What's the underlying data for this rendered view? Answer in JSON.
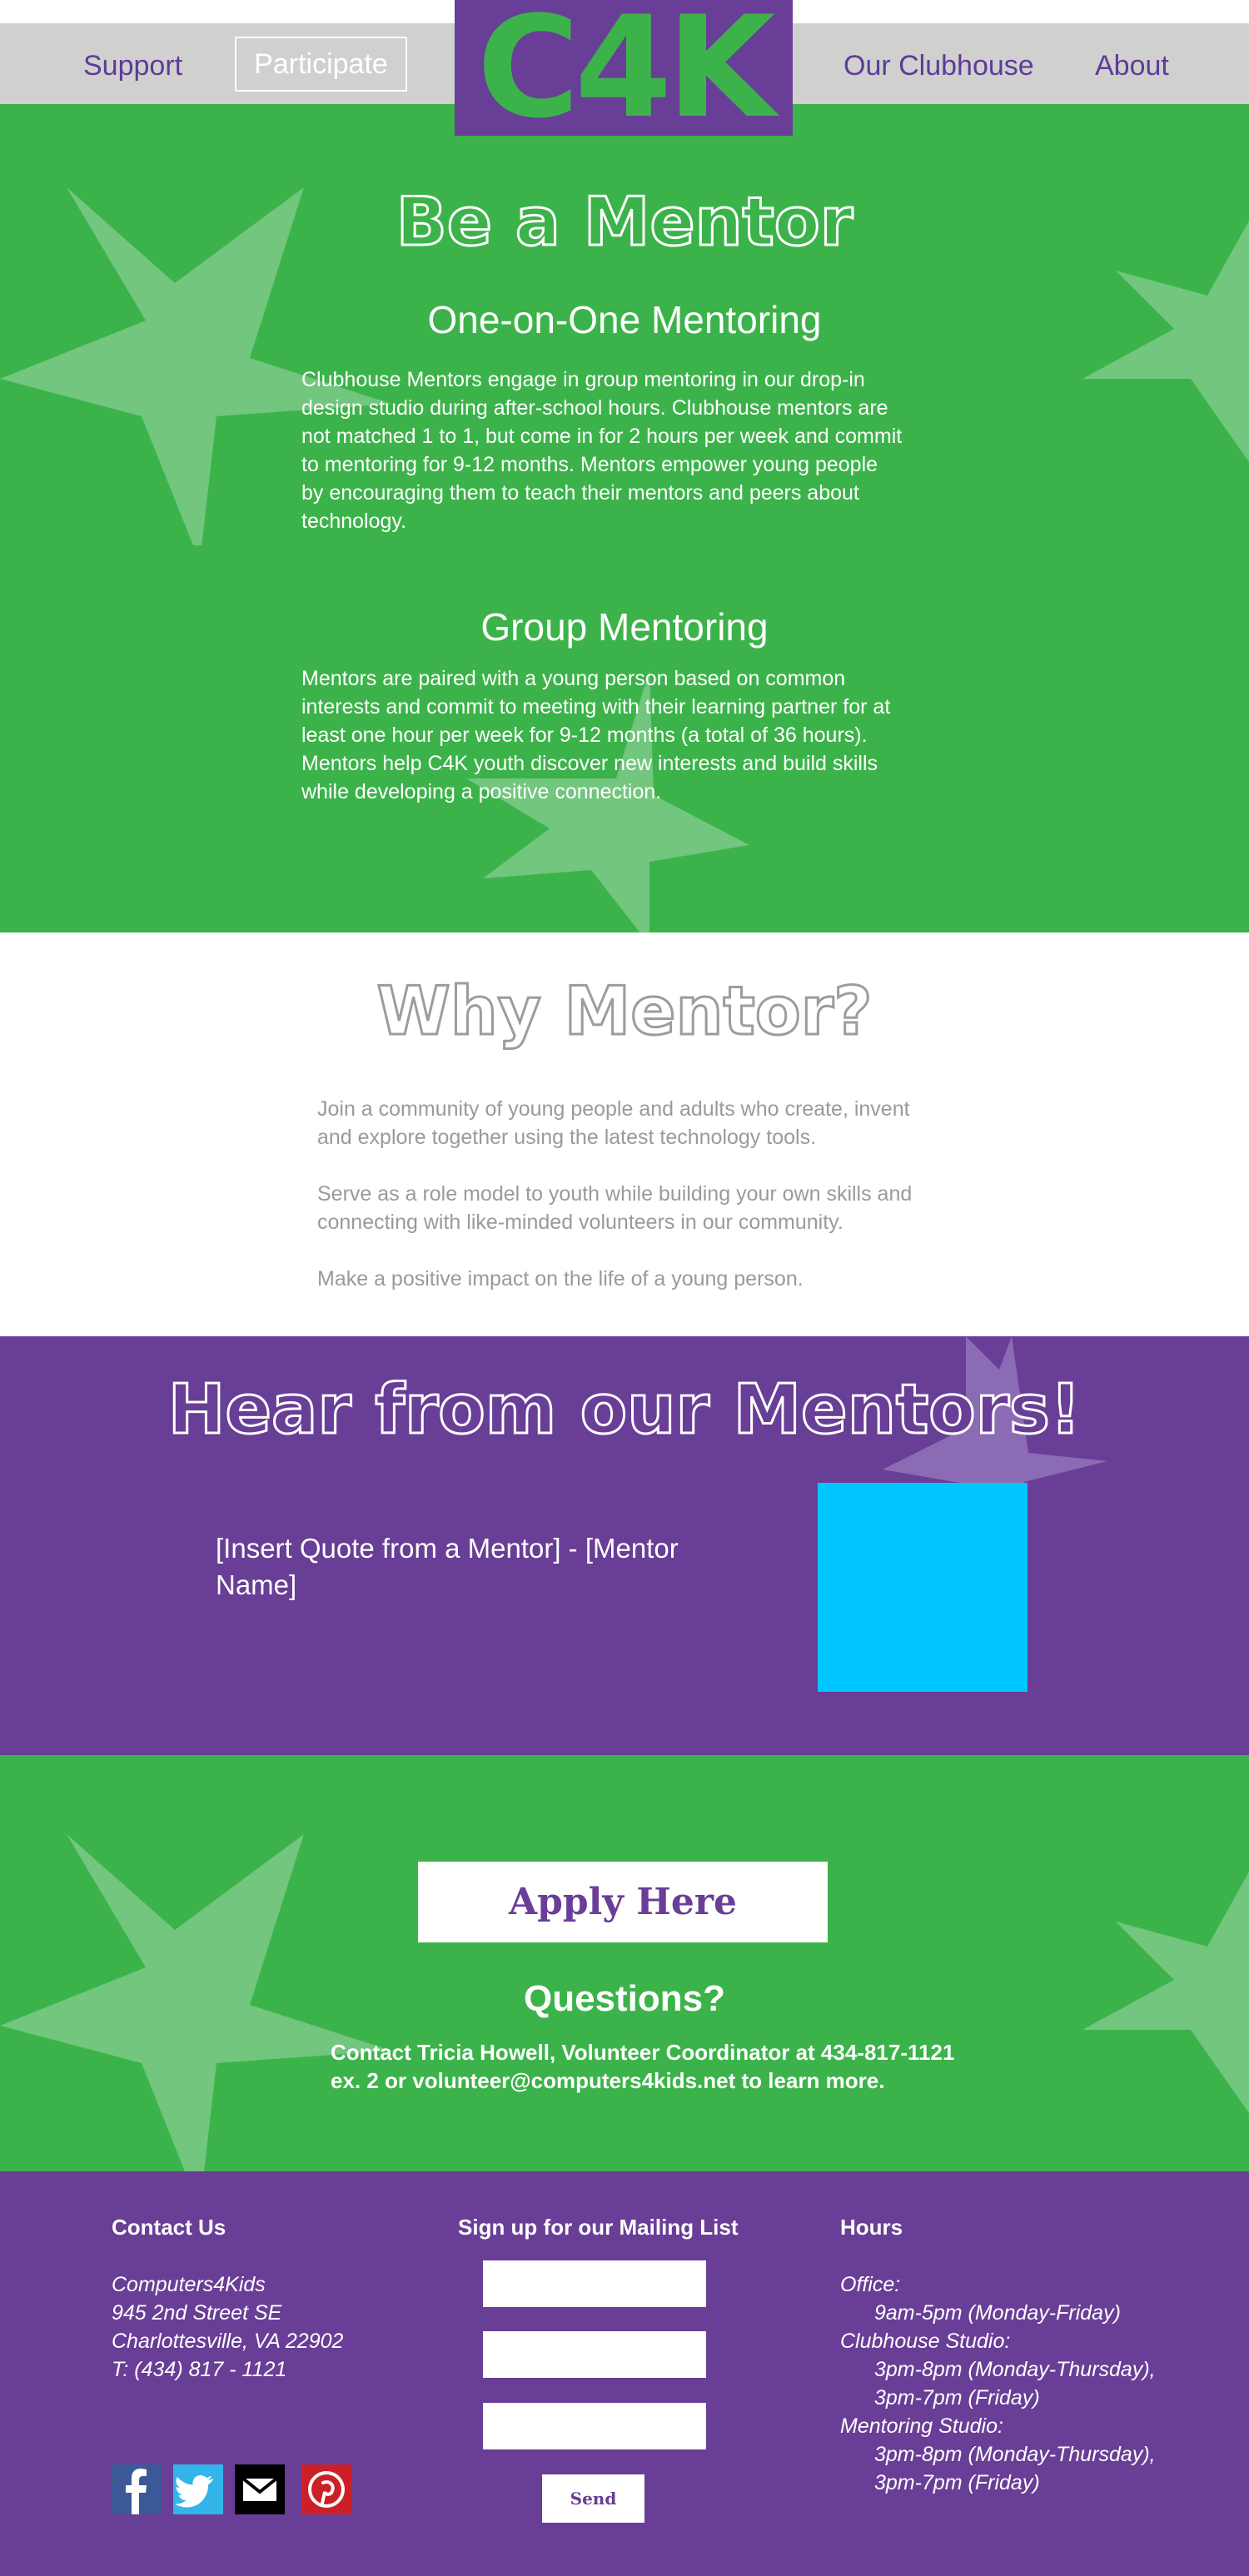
{
  "nav": {
    "support": "Support",
    "participate": "Participate",
    "logo": "C4K",
    "clubhouse": "Our Clubhouse",
    "about": "About"
  },
  "mentor": {
    "title": "Be a Mentor",
    "one_on_one": {
      "heading": "One-on-One Mentoring",
      "lines": [
        "Clubhouse Mentors engage in group mentoring in our drop-in",
        "design studio during after-school hours.  Clubhouse mentors are",
        "not matched 1 to 1, but come in for 2 hours per week and commit",
        "to mentoring for 9-12 months.  Mentors empower young people",
        "by encouraging them to teach their mentors and peers about",
        "technology."
      ]
    },
    "group": {
      "heading": "Group Mentoring",
      "lines": [
        "Mentors are paired with a young person based on common",
        "interests and commit to meeting with their learning partner for at",
        "least one hour per week for 9-12 months (a total of 36 hours).",
        "Mentors help C4K youth discover new interests and build skills",
        "while developing a positive connection."
      ]
    }
  },
  "why": {
    "title": "Why Mentor?",
    "paragraphs": [
      [
        "Join a community of young people and adults who create, invent",
        "and explore together using the latest technology tools."
      ],
      [
        "Serve as a role model to youth while building your own skills and",
        "connecting with like-minded volunteers in our community."
      ],
      [
        "Make  a positive impact on the life of a young person."
      ]
    ]
  },
  "hear": {
    "title": "Hear from our Mentors!",
    "quote_lines": [
      "[Insert Quote from a Mentor] - [Mentor",
      "Name]"
    ]
  },
  "apply": {
    "button": "Apply Here",
    "questions": "Questions?",
    "contact_lines": [
      "Contact Tricia Howell, Volunteer Coordinator at 434-817-1121",
      "ex. 2 or volunteer@computers4kids.net to learn more."
    ]
  },
  "footer": {
    "contact_heading": "Contact Us",
    "address_lines": [
      "Computers4Kids",
      "945 2nd Street SE",
      "Charlottesville, VA 22902",
      "T: (434) 817 - 1121"
    ],
    "mailing_heading": "Sign up for our Mailing List",
    "send": "Send",
    "hours_heading": "Hours",
    "hours_lines": [
      {
        "text": "Office:",
        "indent": false
      },
      {
        "text": "9am-5pm (Monday-Friday)",
        "indent": true
      },
      {
        "text": "Clubhouse Studio:",
        "indent": false
      },
      {
        "text": "3pm-8pm (Monday-Thursday),",
        "indent": true
      },
      {
        "text": "3pm-7pm (Friday)",
        "indent": true
      },
      {
        "text": "Mentoring Studio:",
        "indent": false
      },
      {
        "text": "3pm-8pm (Monday-Thursday),",
        "indent": true
      },
      {
        "text": "3pm-7pm (Friday)",
        "indent": true
      }
    ],
    "social": [
      "facebook-icon",
      "twitter-icon",
      "email-icon",
      "pinterest-icon"
    ]
  },
  "colors": {
    "green": "#3cb34a",
    "purple": "#693e96",
    "light_star_green": "#72c67d",
    "light_star_purple": "#8a6bb4",
    "photo_placeholder": "#00c6ff",
    "nav_bg": "#d0d0cf"
  }
}
